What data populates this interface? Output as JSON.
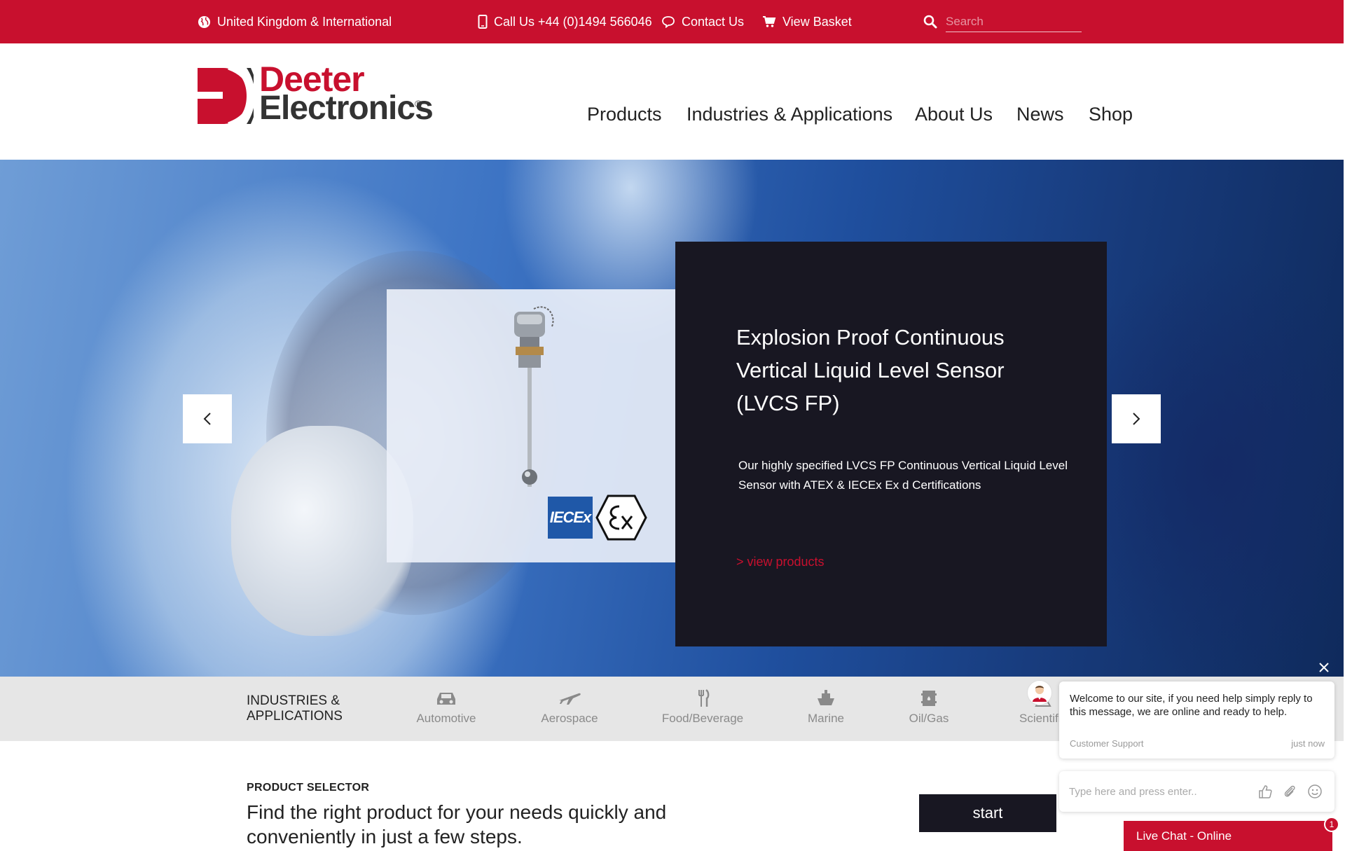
{
  "topbar": {
    "region": "United Kingdom & International",
    "phone": "Call Us +44 (0)1494 566046",
    "contact": "Contact Us",
    "basket": "View Basket",
    "search_placeholder": "Search"
  },
  "brand": {
    "line1": "Deeter",
    "line2": "Electronics",
    "registered": "®",
    "red": "#c8102e",
    "dark": "#181722"
  },
  "nav": {
    "products": "Products",
    "industries": "Industries & Applications",
    "about": "About Us",
    "news": "News",
    "shop": "Shop"
  },
  "hero": {
    "title": "Explosion Proof Continuous Vertical Liquid Level Sensor (LVCS FP)",
    "description": "Our highly specified LVCS FP Continuous Vertical Liquid Level Sensor with ATEX & IECEx Ex d Certifications",
    "link": "> view products",
    "badge_iecex": "IECEx"
  },
  "industries": {
    "title": "INDUSTRIES & APPLICATIONS",
    "items": [
      {
        "label": "Automotive",
        "icon": "car-icon"
      },
      {
        "label": "Aerospace",
        "icon": "airplane-icon"
      },
      {
        "label": "Food/Beverage",
        "icon": "fork-knife-icon"
      },
      {
        "label": "Marine",
        "icon": "ship-icon"
      },
      {
        "label": "Oil/Gas",
        "icon": "oil-barrel-icon"
      },
      {
        "label": "Scientific",
        "icon": "flask-icon"
      }
    ]
  },
  "selector": {
    "label": "PRODUCT SELECTOR",
    "text": "Find the right product for your needs quickly and conveniently in just a few steps.",
    "button": "start"
  },
  "chat": {
    "message": "Welcome to our site, if you need help simply reply to this message, we are online and ready to help.",
    "from": "Customer Support",
    "time": "just now",
    "input_placeholder": "Type here and press enter..",
    "bar": "Live Chat - Online",
    "badge": "1"
  }
}
